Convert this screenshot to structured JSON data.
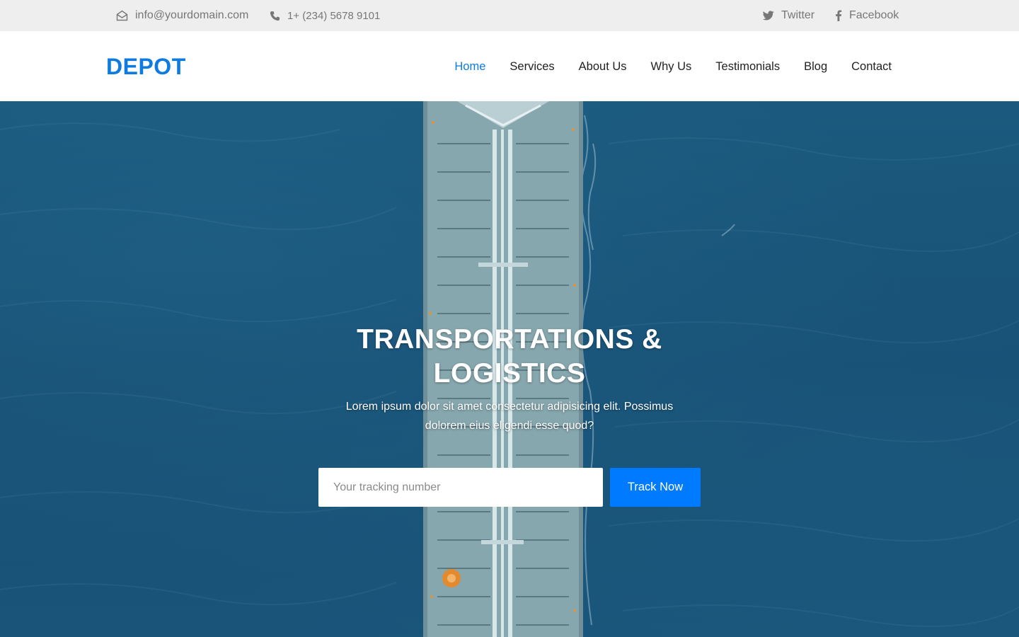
{
  "topbar": {
    "email": "info@yourdomain.com",
    "phone": "1+ (234) 5678 9101",
    "twitter": "Twitter",
    "facebook": "Facebook"
  },
  "header": {
    "logo": "DEPOT",
    "nav": [
      "Home",
      "Services",
      "About Us",
      "Why Us",
      "Testimonials",
      "Blog",
      "Contact"
    ],
    "active_nav": "Home"
  },
  "hero": {
    "title": "TRANSPORTATIONS & LOGISTICS",
    "subtitle": "Lorem ipsum dolor sit amet consectetur adipisicing elit. Possimus dolorem eius eligendi esse quod?",
    "tracking_placeholder": "Your tracking number",
    "track_button": "Track Now"
  },
  "icons": {
    "email": "envelope-open-icon",
    "phone": "phone-icon",
    "twitter": "twitter-icon",
    "facebook": "facebook-icon"
  },
  "colors": {
    "brand": "#0d7be0",
    "button": "#007bff",
    "topbar_bg": "#eeeeee",
    "ocean": "#174f73"
  }
}
